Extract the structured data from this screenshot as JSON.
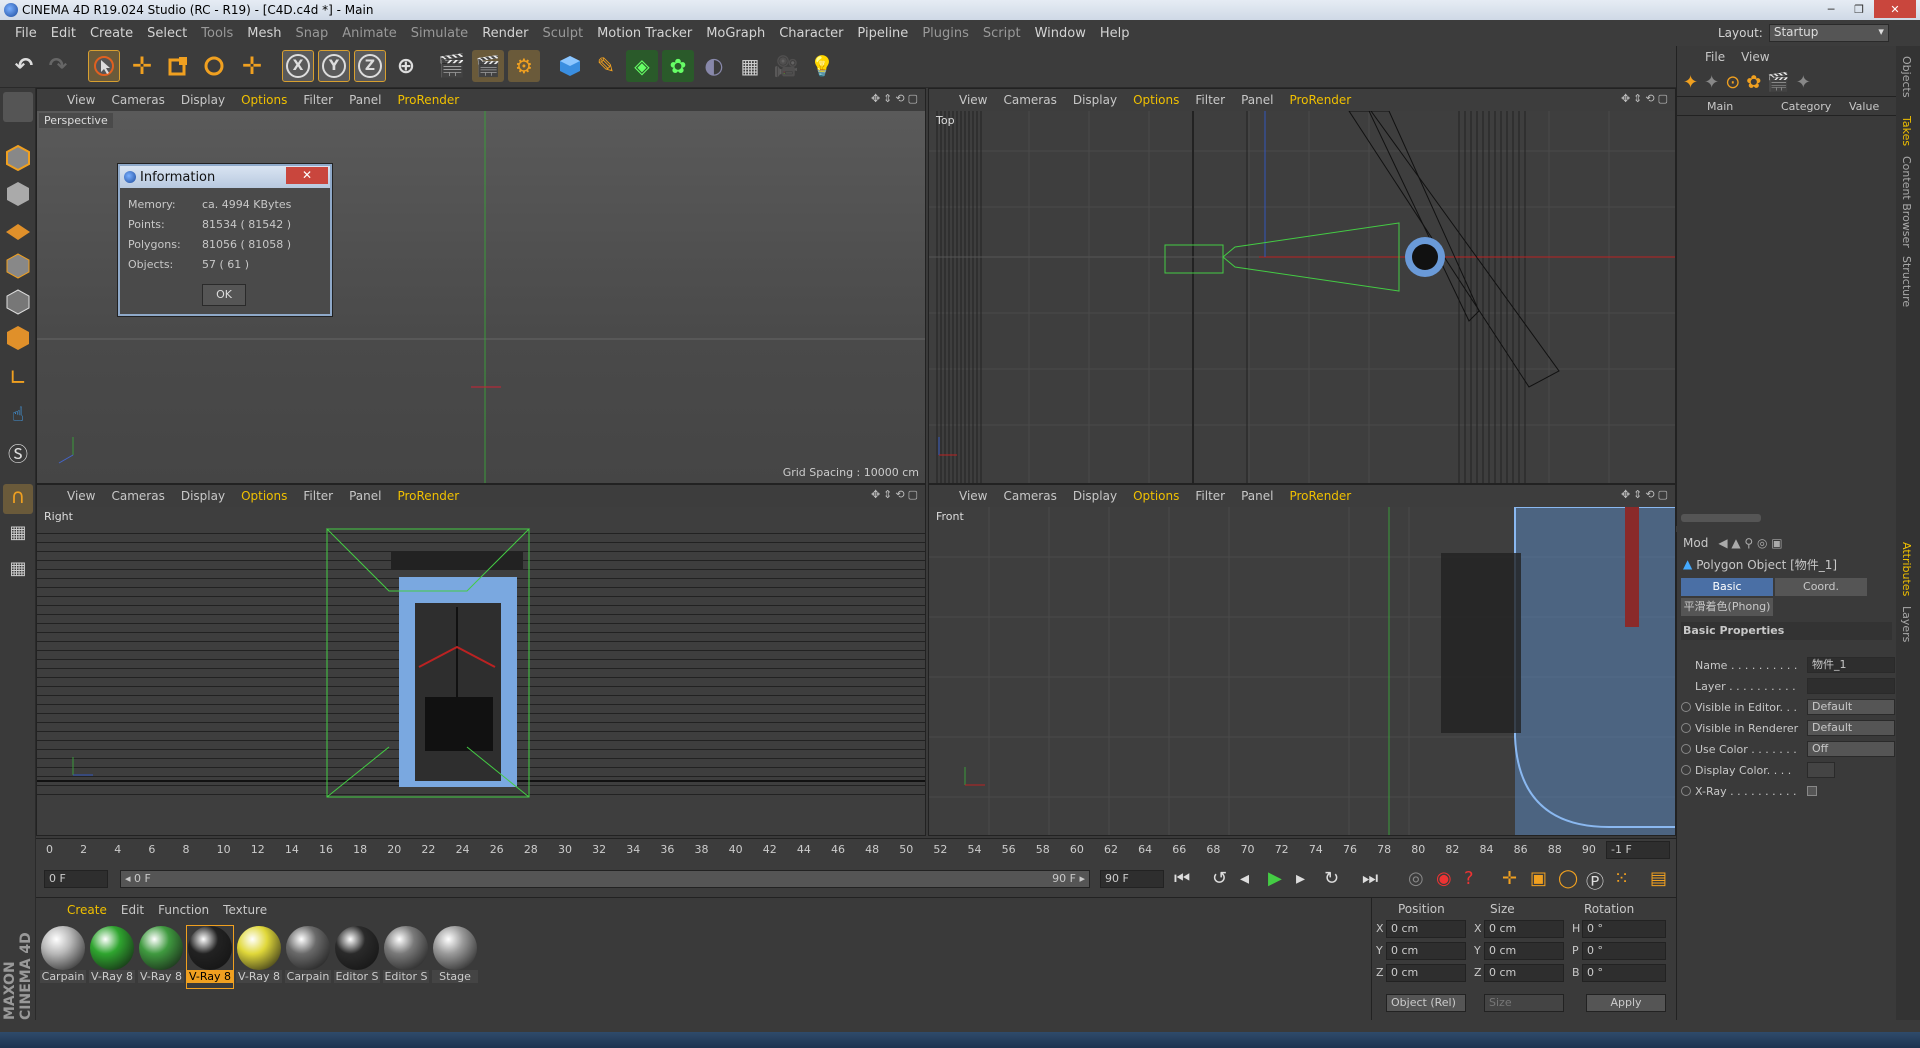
{
  "window": {
    "title": "CINEMA 4D R19.024 Studio (RC - R19) - [C4D.c4d *] - Main",
    "buttons": [
      "─",
      "❐",
      "✕"
    ]
  },
  "menu": [
    "File",
    "Edit",
    "Create",
    "Select",
    "Tools",
    "Mesh",
    "Snap",
    "Animate",
    "Simulate",
    "Render",
    "Sculpt",
    "Motion Tracker",
    "MoGraph",
    "Character",
    "Pipeline",
    "Plugins",
    "Script",
    "Window",
    "Help"
  ],
  "layout": {
    "label": "Layout:",
    "value": "Startup"
  },
  "viewport_menu": {
    "view": "View",
    "cameras": "Cameras",
    "display": "Display",
    "options": "Options",
    "filter": "Filter",
    "panel": "Panel",
    "prorender": "ProRender"
  },
  "viewports": {
    "perspective": {
      "name": "Perspective",
      "grid": "Grid Spacing : 10000 cm"
    },
    "top": {
      "name": "Top"
    },
    "right": {
      "name": "Right"
    },
    "front": {
      "name": "Front"
    }
  },
  "dialog": {
    "title": "Information",
    "close": "✕",
    "rows": [
      {
        "k": "Memory:",
        "v": "ca. 4994 KBytes"
      },
      {
        "k": "Points:",
        "v": "81534 ( 81542 )"
      },
      {
        "k": "Polygons:",
        "v": "81056 ( 81058 )"
      },
      {
        "k": "Objects:",
        "v": "57 ( 61 )"
      }
    ],
    "ok": "OK"
  },
  "timeline": {
    "ticks": [
      "0",
      "2",
      "4",
      "6",
      "8",
      "10",
      "12",
      "14",
      "16",
      "18",
      "20",
      "22",
      "24",
      "26",
      "28",
      "30",
      "32",
      "34",
      "36",
      "38",
      "40",
      "42",
      "44",
      "46",
      "48",
      "50",
      "52",
      "54",
      "56",
      "58",
      "60",
      "62",
      "64",
      "66",
      "68",
      "70",
      "72",
      "74",
      "76",
      "78",
      "80",
      "82",
      "84",
      "86",
      "88",
      "90"
    ],
    "current_end": "-1 F",
    "start_field": "0 F",
    "slider_start": "◂ 0 F",
    "slider_end": "90 F ▸",
    "end_field": "90 F"
  },
  "materials": {
    "menu": [
      "Create",
      "Edit",
      "Function",
      "Texture"
    ],
    "items": [
      {
        "label": "Carpain",
        "color": "#b8b8b8"
      },
      {
        "label": "V-Ray 8",
        "color": "#2fa52f"
      },
      {
        "label": "V-Ray 8",
        "color": "#3f9a3f"
      },
      {
        "label": "V-Ray 8",
        "color": "#222222"
      },
      {
        "label": "V-Ray 8",
        "color": "#e0d83a"
      },
      {
        "label": "Carpain",
        "color": "#6a6a6a"
      },
      {
        "label": "Editor S",
        "color": "#2a2a2a"
      },
      {
        "label": "Editor S",
        "color": "#7a7a7a"
      },
      {
        "label": "Stage",
        "color": "#9a9a9a"
      }
    ]
  },
  "coords": {
    "headers": [
      "Position",
      "Size",
      "Rotation"
    ],
    "rows": [
      {
        "a": "X",
        "p": "0 cm",
        "b": "X",
        "s": "0 cm",
        "c": "H",
        "r": "0 °"
      },
      {
        "a": "Y",
        "p": "0 cm",
        "b": "Y",
        "s": "0 cm",
        "c": "P",
        "r": "0 °"
      },
      {
        "a": "Z",
        "p": "0 cm",
        "b": "Z",
        "s": "0 cm",
        "c": "B",
        "r": "0 °"
      }
    ],
    "mode": "Object (Rel)",
    "size_mode": "Size",
    "apply": "Apply"
  },
  "objects_panel": {
    "menu": [
      "File",
      "View"
    ],
    "columns": [
      "Main",
      "Category",
      "Value"
    ]
  },
  "attributes": {
    "mode": "Mod",
    "object_title": "Polygon Object [物件_1]",
    "tabs": [
      "Basic",
      "Coord."
    ],
    "subtab": "平滑着色(Phong)",
    "section": "Basic Properties",
    "rows": [
      {
        "label": "Name . . . . . . . . . .",
        "value": "物件_1"
      },
      {
        "label": "Layer . . . . . . . . . .",
        "value": ""
      },
      {
        "label": "Visible in Editor. . .",
        "value": "Default"
      },
      {
        "label": "Visible in Renderer",
        "value": "Default"
      },
      {
        "label": "Use Color . . . . . . .",
        "value": "Off"
      },
      {
        "label": "Display Color. . . .",
        "value": ""
      },
      {
        "label": "X-Ray . . . . . . . . . .",
        "value": ""
      }
    ]
  },
  "side_tabs": [
    "Objects",
    "Takes",
    "Content Browser",
    "Structure",
    "Attributes",
    "Layers"
  ],
  "brand": "MAXON CINEMA 4D"
}
